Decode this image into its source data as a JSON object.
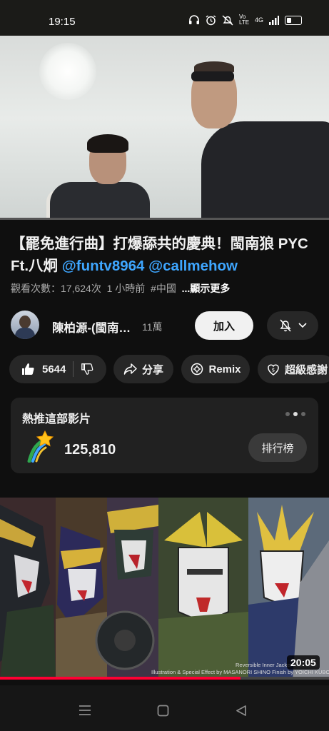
{
  "status_bar": {
    "time": "19:15",
    "network": "4G",
    "volte": "Vo LTE"
  },
  "video": {
    "title_main": "【罷免進行曲】打爆舔共的慶典！閩南狼 PYC Ft.八炯 ",
    "mention_1": "@funtv8964",
    "mention_2": "@callmehow",
    "views": "觀看次數：17,624次",
    "age": "1 小時前",
    "hashtag": "#中國",
    "show_more": "...顯示更多",
    "progress_fraction": 0
  },
  "channel": {
    "name": "陳柏源-(閩南…",
    "subscribers": "11萬",
    "join_label": "加入"
  },
  "actions": {
    "likes": "5644",
    "share_label": "分享",
    "remix_label": "Remix",
    "super_thanks_label": "超級感謝"
  },
  "hype_card": {
    "title": "熱推這部影片",
    "count": "125,810",
    "leaderboard_label": "排行榜",
    "page_dots": 3,
    "active_dot": 2
  },
  "next_video": {
    "duration": "20:05",
    "credit_line_1": "Reversible Inner Jacket   Illustration",
    "credit_line_2": "Illustration & Special Effect by MASANORI SHINO  Finish by YOICHI KUBOKI",
    "progress_fraction": 0.73
  },
  "colors": {
    "background": "#0f0f0f",
    "link": "#3ea6ff",
    "progress_red": "#ff0033",
    "pill": "#272727"
  }
}
